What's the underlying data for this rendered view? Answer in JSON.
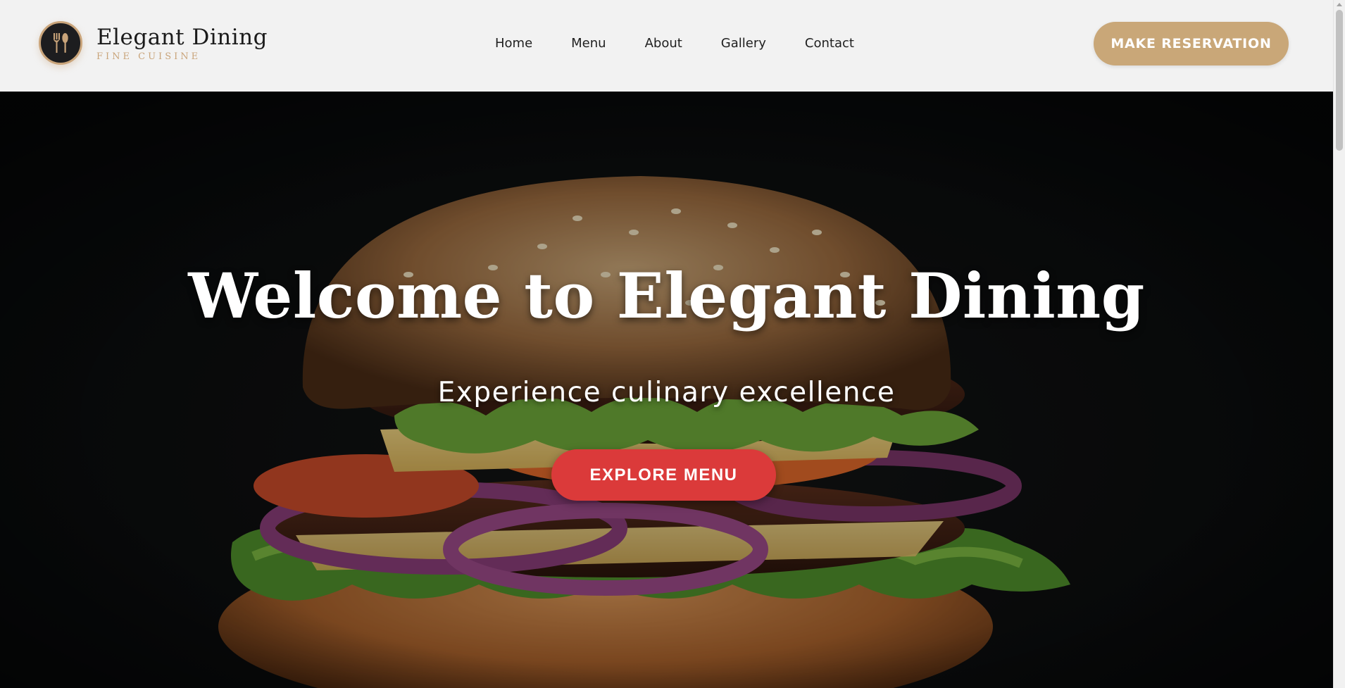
{
  "brand": {
    "title": "Elegant Dining",
    "subtitle": "FINE CUISINE",
    "logo_icon": "fork-spoon-icon",
    "accent_color": "#c9a47a"
  },
  "nav": {
    "items": [
      {
        "label": "Home"
      },
      {
        "label": "Menu"
      },
      {
        "label": "About"
      },
      {
        "label": "Gallery"
      },
      {
        "label": "Contact"
      }
    ]
  },
  "header": {
    "reserve_label": "MAKE RESERVATION",
    "reserve_color": "#c9a778"
  },
  "hero": {
    "title": "Welcome to Elegant Dining",
    "subtitle": "Experience culinary excellence",
    "cta_label": "EXPLORE MENU",
    "cta_color": "#db3a3a",
    "background_image": "burger-photo"
  }
}
